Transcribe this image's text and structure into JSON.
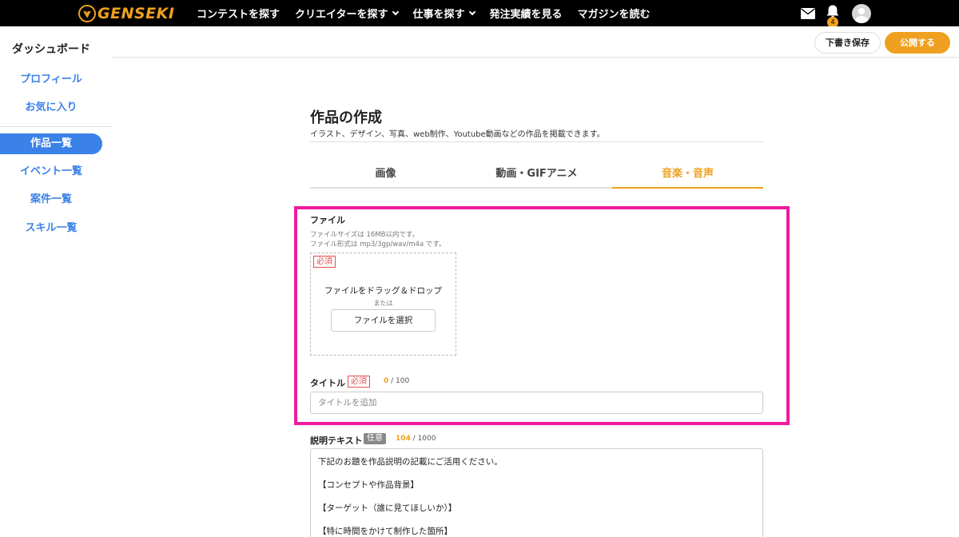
{
  "nav": {
    "logo_text": "GENSEKI",
    "links": [
      {
        "label": "コンテストを探す",
        "dropdown": false
      },
      {
        "label": "クリエイターを探す",
        "dropdown": true
      },
      {
        "label": "仕事を探す",
        "dropdown": true
      },
      {
        "label": "発注実績を見る",
        "dropdown": false
      },
      {
        "label": "マガジンを読む",
        "dropdown": false
      }
    ],
    "notification_count": "4",
    "accent_color": "#f0a020"
  },
  "sidebar": {
    "title": "ダッシュボード",
    "items": [
      {
        "label": "プロフィール"
      },
      {
        "label": "お気に入り"
      },
      {
        "label": "作品一覧",
        "active": true
      },
      {
        "label": "イベント一覧"
      },
      {
        "label": "案件一覧"
      },
      {
        "label": "スキル一覧"
      }
    ]
  },
  "actions": {
    "draft_label": "下書き保存",
    "publish_label": "公開する"
  },
  "page": {
    "title": "作品の作成",
    "subtitle": "イラスト、デザイン、写真、web制作、Youtube動画などの作品を掲載できます。"
  },
  "tabs": [
    {
      "label": "画像"
    },
    {
      "label": "動画・GIFアニメ"
    },
    {
      "label": "音楽・音声",
      "active": true
    }
  ],
  "file_field": {
    "label": "ファイル",
    "hint_size": "ファイルサイズは 16MB以内です。",
    "hint_format": "ファイル形式は mp3/3gp/wav/m4a です。",
    "required_tag": "必須",
    "drop_text": "ファイルをドラッグ＆ドロップ",
    "or_text": "または",
    "select_button": "ファイルを選択"
  },
  "title_field": {
    "label": "タイトル",
    "required_tag": "必須",
    "count": "0",
    "max": "/ 100",
    "placeholder": "タイトルを追加",
    "value": ""
  },
  "desc_field": {
    "label": "説明テキスト",
    "optional_tag": "任意",
    "count": "104",
    "max": "/ 1000",
    "lines": [
      "下記のお題を作品説明の記載にご活用ください。",
      "【コンセプトや作品背景】",
      "【ターゲット（誰に見てほしいか）】",
      "【特に時間をかけて制作した箇所】"
    ]
  },
  "highlight_color": "#ee1c9b"
}
